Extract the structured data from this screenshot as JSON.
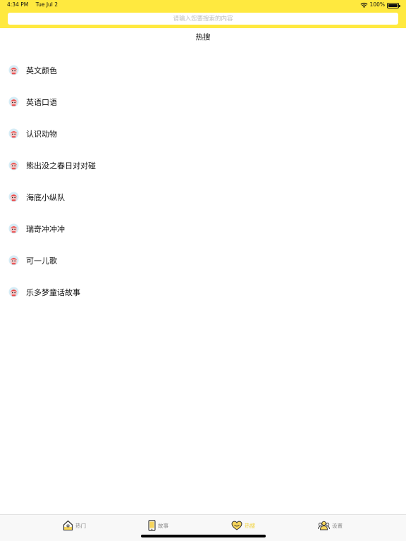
{
  "status_bar": {
    "time": "4:34 PM",
    "date": "Tue Jul 2",
    "battery": "100%"
  },
  "search": {
    "placeholder": "请输入您要搜索的内容"
  },
  "section": {
    "title": "热搜"
  },
  "hot_list": [
    {
      "label": "英文颜色",
      "icon": "mascot-icon"
    },
    {
      "label": "英语口语",
      "icon": "mascot-icon"
    },
    {
      "label": "认识动物",
      "icon": "mascot-icon"
    },
    {
      "label": "熊出没之春日对对碰",
      "icon": "mascot-icon"
    },
    {
      "label": "海底小纵队",
      "icon": "mascot-icon"
    },
    {
      "label": "瑞奇冲冲冲",
      "icon": "mascot-icon"
    },
    {
      "label": "可一儿歌",
      "icon": "mascot-icon"
    },
    {
      "label": "乐多梦童话故事",
      "icon": "mascot-icon"
    }
  ],
  "tab_bar": {
    "tabs": [
      {
        "label": "热门",
        "icon": "home-icon",
        "active": false
      },
      {
        "label": "故事",
        "icon": "phone-icon",
        "active": false
      },
      {
        "label": "热搜",
        "icon": "heart-icon",
        "active": true
      },
      {
        "label": "设置",
        "icon": "users-icon",
        "active": false
      }
    ]
  },
  "colors": {
    "header_yellow": "#ffe93f",
    "active_tab": "#f1d23a",
    "inactive_tab": "#8a8a8a"
  }
}
